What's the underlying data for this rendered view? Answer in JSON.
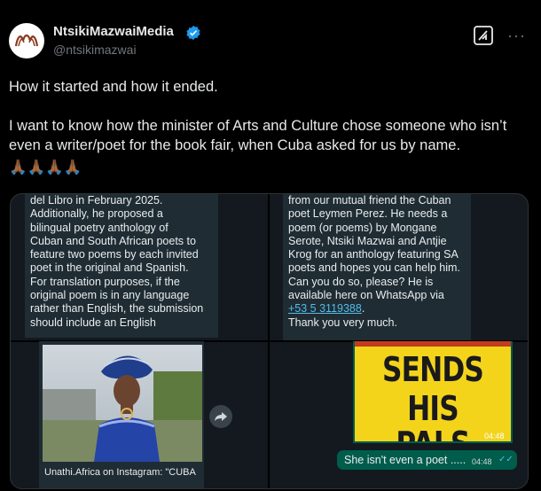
{
  "tweet": {
    "display_name": "NtsikiMazwaiMedia",
    "handle": "@ntsikimazwai",
    "text": "How it started and how it ended.\n\nI want to know how the minister of Arts and Culture chose someone who isn’t even a writer/poet for the book fair, when Cuba asked for us by name.",
    "emoji": "🙏🏾🙏🏾🙏🏾🙏🏾",
    "more": "···"
  },
  "chat_left": {
    "lines": [
      "del Libro in February 2025.",
      "Additionally, he proposed a",
      "bilingual poetry anthology of",
      "Cuban and South African poets to",
      "feature two poems by each invited",
      "poet in the original and Spanish.",
      "For translation purposes, if the",
      "original poem is in any language",
      "rather than English, the submission",
      "should include an English"
    ]
  },
  "chat_right": {
    "line1": "from our mutual friend the Cuban",
    "line2": "poet Leymen Perez. He needs a",
    "line3": "poem (or poems) by Mongane",
    "line4": "Serote, Ntsiki Mazwai and Antjie",
    "line5": "Krog for an anthology featuring SA",
    "line6": "poets and hopes you can help him.",
    "line7": "Can you do so, please?  He is",
    "line8": "available here on WhatsApp via",
    "phone": "+53 5 3119388",
    "phone_suffix": ".",
    "thanks": "Thank you very much."
  },
  "chat_bottom": {
    "ig_caption": "Unathi.Africa on Instagram: \"CUBA",
    "poster_line1": "SENDS",
    "poster_line2": "HIS PALS",
    "poster_time": "04:48",
    "out_message": "She isn't even a poet .....",
    "out_time": "04:48"
  },
  "colors": {
    "background": "#000000",
    "verified": "#1d9bf0",
    "link": "#53bdeb",
    "outgoing_bubble": "#005c4b",
    "incoming_bubble": "#1f2c33",
    "poster_yellow": "#f3d41b"
  },
  "icons": [
    "verified-badge-icon",
    "grok-icon",
    "more-icon",
    "forward-icon",
    "double-check-icon"
  ]
}
